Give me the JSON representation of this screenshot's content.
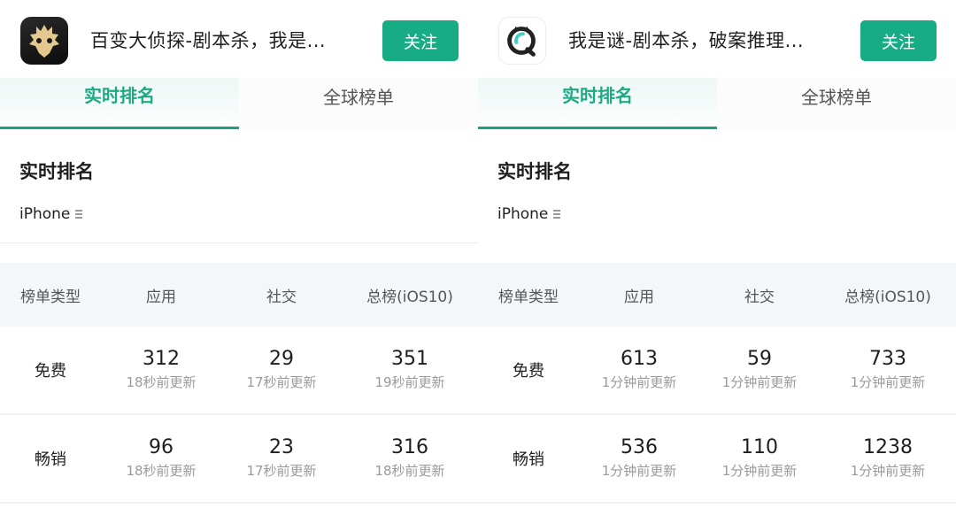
{
  "theme": {
    "accent": "#17ac84",
    "tab_active": "#1fa883"
  },
  "panels": [
    {
      "app": {
        "icon": "detective-mask-icon",
        "title": "百变大侦探-剧本杀，我是...",
        "follow_label": "关注"
      },
      "tabs": [
        {
          "label": "实时排名",
          "active": true
        },
        {
          "label": "全球榜单",
          "active": false
        }
      ],
      "section_title": "实时排名",
      "device": {
        "label": "iPhone",
        "icon": "menu-icon"
      },
      "table": {
        "headers": [
          "榜单类型",
          "应用",
          "社交",
          "总榜(iOS10)"
        ],
        "rows": [
          {
            "label": "免费",
            "cells": [
              {
                "rank": "312",
                "updated": "18秒前更新"
              },
              {
                "rank": "29",
                "updated": "17秒前更新"
              },
              {
                "rank": "351",
                "updated": "19秒前更新"
              }
            ]
          },
          {
            "label": "畅销",
            "cells": [
              {
                "rank": "96",
                "updated": "18秒前更新"
              },
              {
                "rank": "23",
                "updated": "17秒前更新"
              },
              {
                "rank": "316",
                "updated": "18秒前更新"
              }
            ]
          }
        ]
      }
    },
    {
      "app": {
        "icon": "magnifier-q-icon",
        "title": "我是谜-剧本杀，破案推理...",
        "follow_label": "关注"
      },
      "tabs": [
        {
          "label": "实时排名",
          "active": true
        },
        {
          "label": "全球榜单",
          "active": false
        }
      ],
      "section_title": "实时排名",
      "device": {
        "label": "iPhone",
        "icon": "menu-icon"
      },
      "table": {
        "headers": [
          "榜单类型",
          "应用",
          "社交",
          "总榜(iOS10)"
        ],
        "rows": [
          {
            "label": "免费",
            "cells": [
              {
                "rank": "613",
                "updated": "1分钟前更新"
              },
              {
                "rank": "59",
                "updated": "1分钟前更新"
              },
              {
                "rank": "733",
                "updated": "1分钟前更新"
              }
            ]
          },
          {
            "label": "畅销",
            "cells": [
              {
                "rank": "536",
                "updated": "1分钟前更新"
              },
              {
                "rank": "110",
                "updated": "1分钟前更新"
              },
              {
                "rank": "1238",
                "updated": "1分钟前更新"
              }
            ]
          }
        ]
      }
    }
  ]
}
